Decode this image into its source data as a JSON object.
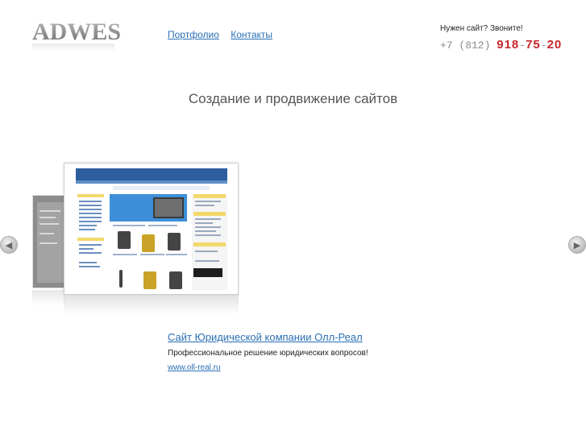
{
  "logo": {
    "text": "ADWES"
  },
  "nav": {
    "items": [
      {
        "label": "Портфолио"
      },
      {
        "label": "Контакты"
      }
    ]
  },
  "contact": {
    "call_text": "Нужен сайт? Звоните!",
    "phone_prefix": "+7 (812)",
    "phone_part1": "918",
    "phone_part2": "75",
    "phone_part3": "20",
    "separator": "-",
    "accent_color": "#c8262b"
  },
  "tagline": "Создание и продвижение сайтов",
  "portfolio": {
    "current": {
      "title": "Сайт Юридической компании Олл-Реал",
      "description": "Профессиональное решение юридических вопросов!",
      "url": "www.oll-real.ru"
    },
    "prev_arrow_icon": "chevron-left-icon",
    "next_arrow_icon": "chevron-right-icon"
  },
  "colors": {
    "link": "#2a6fb5",
    "text": "#222222",
    "logo_gray": "#8a8a8a"
  }
}
